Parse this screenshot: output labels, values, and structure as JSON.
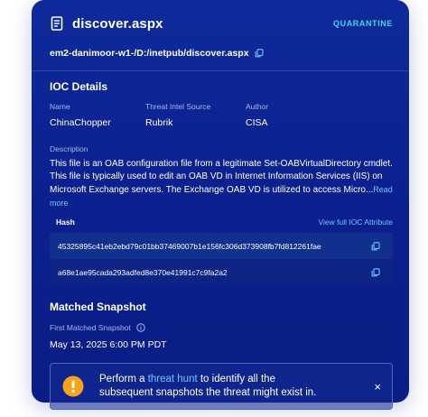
{
  "header": {
    "title": "discover.aspx",
    "status": "QUARANTINE"
  },
  "path": "em2-danimoor-w1-/D:/inetpub/discover.aspx",
  "ioc": {
    "section_title": "IOC Details",
    "fields": [
      {
        "label": "Name",
        "value": "ChinaChopper"
      },
      {
        "label": "Threat Intel Source",
        "value": "Rubrik"
      },
      {
        "label": "Author",
        "value": "CISA"
      }
    ],
    "description_label": "Description",
    "description": "This file is an OAB configuration file from a legitimate Set-OABVirtualDirectory cmdlet. This file is typically used to edit an OAB VD in Internet Information Services (IIS) on Microsoft Exchange servers. The Exchange OAB VD is utilized to access Micro...",
    "read_more": "Read more",
    "hash_title": "Hash",
    "hash_link": "View full IOC Attribute",
    "hashes": [
      "45325895c41eb2ebd79c01bb37469007b1e156fc306d373908fb7fd812261fae",
      "a68e1ae95cada293adfed8e370e41991c7c9fa2a2"
    ]
  },
  "matched": {
    "section_title": "Matched Snapshot",
    "first_label": "First Matched Snapshot",
    "first_value": "May 13, 2025 6:00 PM PDT"
  },
  "banner": {
    "text_before": "Perform a ",
    "link": "threat hunt",
    "text_after": " to identify all the subsequent snapshots the threat might exist in.",
    "close_label": "×"
  },
  "colors": {
    "card_bg": "#0b2190",
    "accent": "#46d3ea",
    "link": "#6fc6f6",
    "warning": "#f4a41c"
  },
  "icons": {
    "file": "file-text-icon",
    "copy": "copy-icon",
    "info": "info-icon",
    "warning": "warning-icon",
    "close": "close-icon"
  }
}
